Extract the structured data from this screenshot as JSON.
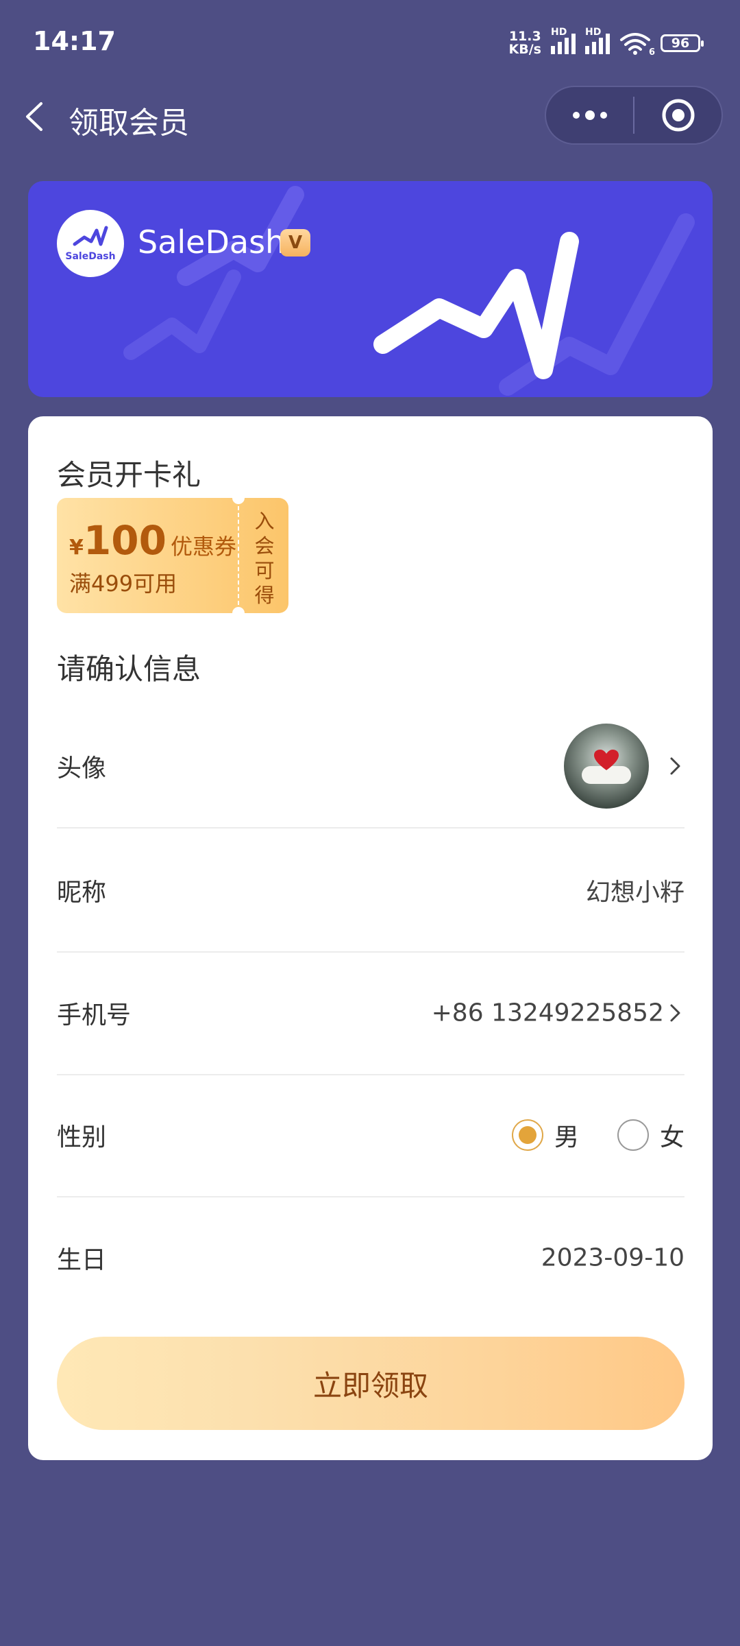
{
  "status_bar": {
    "time": "14:17",
    "net_speed_value": "11.3",
    "net_speed_unit": "KB/s",
    "signal_label": "HD",
    "wifi_label": "6",
    "battery": "96"
  },
  "nav": {
    "title": "领取会员",
    "more_icon": "more-dots-icon",
    "close_icon": "target-circle-icon"
  },
  "banner": {
    "brand_name": "SaleDash",
    "logo_text": "SaleDash",
    "badge": "V",
    "background_color": "#4d46de"
  },
  "gift": {
    "section_title": "会员开卡礼",
    "coupon": {
      "currency": "¥",
      "amount": "100",
      "name": "优惠券",
      "condition": "满499可用",
      "side_text": [
        "入",
        "会",
        "可",
        "得"
      ]
    }
  },
  "form": {
    "section_title": "请确认信息",
    "avatar_label": "头像",
    "nickname_label": "昵称",
    "nickname_value": "幻想小籽",
    "phone_label": "手机号",
    "phone_value": "+86 13249225852",
    "gender_label": "性别",
    "gender_options": [
      "男",
      "女"
    ],
    "gender_selected": "男",
    "birthday_label": "生日",
    "birthday_value": "2023-09-10"
  },
  "claim_button": "立即领取",
  "colors": {
    "page_bg": "#4e4e84",
    "accent_gold": "#e3a43a",
    "coupon_text": "#b25a0d"
  }
}
